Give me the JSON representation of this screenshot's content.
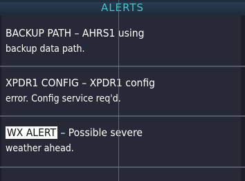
{
  "header": {
    "title": "ALERTS"
  },
  "alerts": [
    {
      "line1": "BACKUP PATH – AHRS1 using",
      "line2": "backup data path."
    },
    {
      "line1": "XPDR1 CONFIG – XPDR1 config",
      "line2": "error. Config service req'd."
    },
    {
      "label": "WX ALERT",
      "line1_rest": " – Possible severe",
      "line2": "weather ahead."
    }
  ],
  "colors": {
    "background": "#1c1f2a",
    "title": "#3ec8c8",
    "text": "#ffffff",
    "divider": "#555b6a",
    "highlight": "#ffffff"
  }
}
